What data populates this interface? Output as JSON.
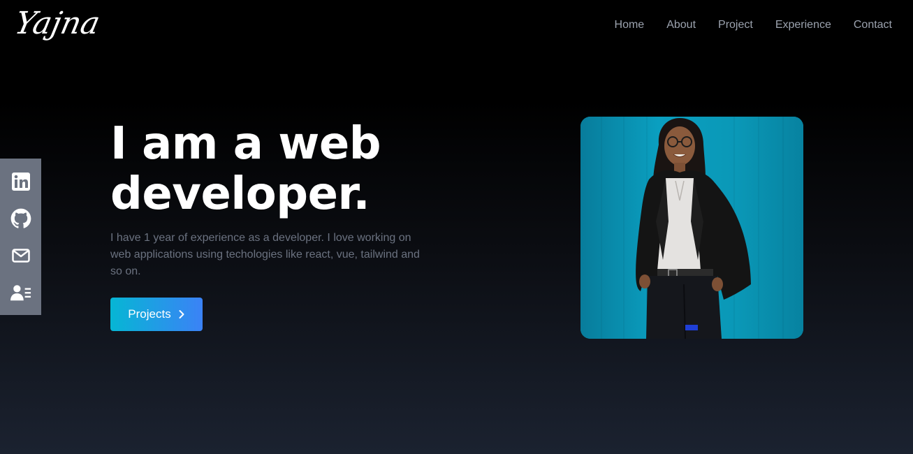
{
  "brand": {
    "logo_text": "Yajna"
  },
  "nav": {
    "items": [
      {
        "label": "Home"
      },
      {
        "label": "About"
      },
      {
        "label": "Project"
      },
      {
        "label": "Experience"
      },
      {
        "label": "Contact"
      }
    ]
  },
  "social": {
    "icons": [
      "linkedin-icon",
      "github-icon",
      "mail-icon",
      "resume-icon"
    ]
  },
  "hero": {
    "title": "I am a web developer.",
    "description": "I have 1 year of experience as a developer. I love working on web applications using techologies like react, vue, tailwind and so on.",
    "button_label": "Projects",
    "button_icon": "chevron-right-icon"
  },
  "colors": {
    "accent_start": "#06b6d4",
    "accent_end": "#3b82f6",
    "nav_text": "#9ca3af",
    "social_bar": "#6b7280",
    "photo_bg": "#0a9ab8"
  }
}
